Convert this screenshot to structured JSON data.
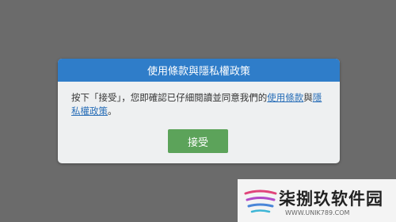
{
  "dialog": {
    "title": "使用條款與隱私權政策",
    "message_prefix": "按下「接受」，您即確認已仔細閱讀並同意我們的",
    "terms_link": "使用條款",
    "conjunction": "與",
    "privacy_link": "隱私權政策",
    "message_suffix": "。",
    "accept_label": "接受"
  },
  "watermark": {
    "title": "柒捌玖软件园",
    "url": "WWW.UNIK789.COM"
  },
  "colors": {
    "backdrop": "#6b6b6b",
    "header": "#2f7dc9",
    "accept_button": "#5ca35a",
    "link": "#2a6fb8"
  }
}
